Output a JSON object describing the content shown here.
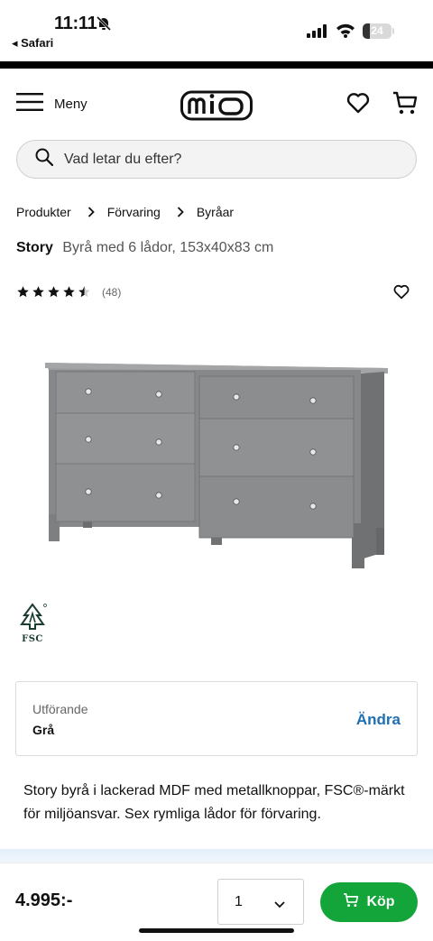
{
  "status_bar": {
    "time": "11:11",
    "back_label": "◂ Safari",
    "battery": "24"
  },
  "header": {
    "menu_label": "Meny",
    "logo_text": "mio"
  },
  "search": {
    "placeholder": "Vad letar du efter?"
  },
  "breadcrumb": [
    "Produkter",
    "Förvaring",
    "Byråar"
  ],
  "product": {
    "brand": "Story",
    "subtitle": "Byrå med 6 lådor, 153x40x83 cm",
    "rating": 4.5,
    "rating_count": "(48)",
    "color": "#8e9092"
  },
  "certification": {
    "label": "FSC"
  },
  "variant": {
    "label": "Utförande",
    "value": "Grå",
    "change_label": "Ändra"
  },
  "description": "Story byrå i lackerad MDF med metallknoppar, FSC®-märkt för miljöansvar. Sex rymliga lådor för förvaring.",
  "purchase": {
    "price": "4.995:-",
    "quantity": "1",
    "buy_label": "Köp",
    "accent": "#14a53a"
  }
}
